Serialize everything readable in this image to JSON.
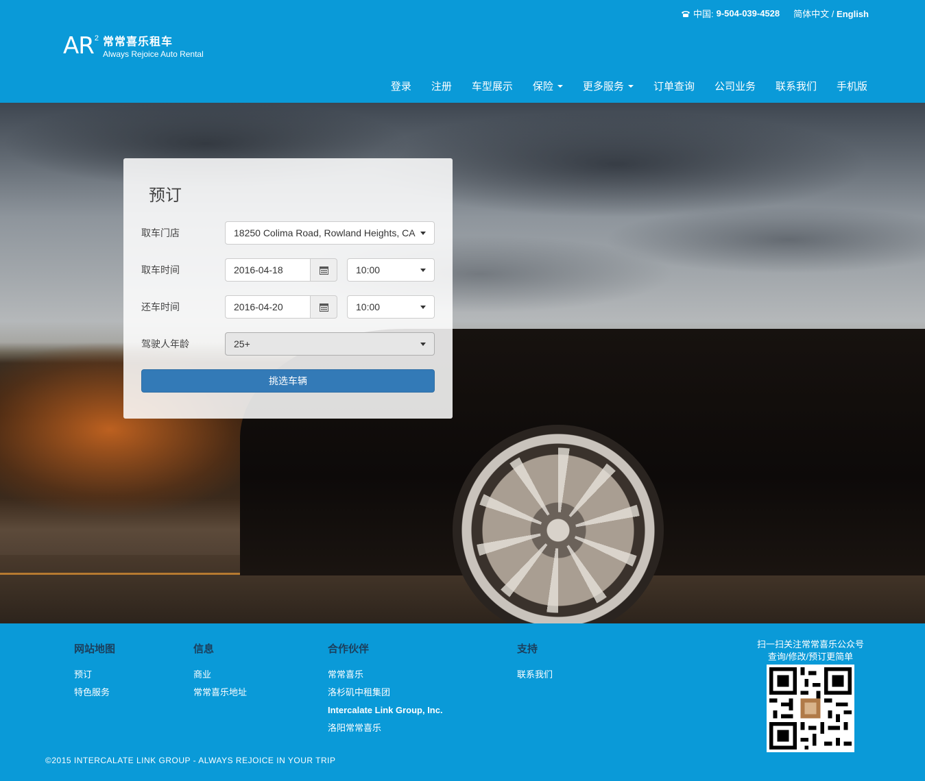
{
  "header": {
    "phone_label": "中国:",
    "phone_number": "9-504-039-4528",
    "lang_cn": "简体中文",
    "lang_sep": "/",
    "lang_en": "English",
    "logo_mark": "AR",
    "logo_sup": "2",
    "logo_cn": "常常喜乐租车",
    "logo_en": "Always Rejoice Auto Rental"
  },
  "nav": {
    "items": [
      {
        "label": "登录",
        "dropdown": false
      },
      {
        "label": "注册",
        "dropdown": false
      },
      {
        "label": "车型展示",
        "dropdown": false
      },
      {
        "label": "保险",
        "dropdown": true
      },
      {
        "label": "更多服务",
        "dropdown": true
      },
      {
        "label": "订单查询",
        "dropdown": false
      },
      {
        "label": "公司业务",
        "dropdown": false
      },
      {
        "label": "联系我们",
        "dropdown": false
      },
      {
        "label": "手机版",
        "dropdown": false
      }
    ]
  },
  "booking": {
    "title": "预订",
    "pickup_store_label": "取车门店",
    "pickup_store_value": "18250 Colima Road, Rowland Heights, CA",
    "pickup_time_label": "取车时间",
    "pickup_date": "2016-04-18",
    "pickup_hour": "10:00",
    "return_time_label": "还车时间",
    "return_date": "2016-04-20",
    "return_hour": "10:00",
    "driver_age_label": "驾驶人年龄",
    "driver_age_value": "25+",
    "submit_label": "挑选车辆"
  },
  "footer": {
    "sitemap": {
      "title": "网站地图",
      "links": [
        "预订",
        "特色服务"
      ]
    },
    "info": {
      "title": "信息",
      "links": [
        "商业",
        "常常喜乐地址"
      ]
    },
    "partners": {
      "title": "合作伙伴",
      "links": [
        "常常喜乐",
        "洛杉矶中租集团",
        "Intercalate Link Group, Inc.",
        "洛阳常常喜乐"
      ]
    },
    "support": {
      "title": "支持",
      "links": [
        "联系我们"
      ]
    },
    "qr_line1": "扫一扫关注常常喜乐公众号",
    "qr_line2": "查询/修改/预订更简单",
    "copyright": "©2015 INTERCALATE LINK GROUP - ALWAYS REJOICE IN YOUR TRIP"
  },
  "colors": {
    "brand_blue": "#0a9ad8",
    "button_blue": "#337ab7",
    "footer_heading": "#1c3f5c"
  },
  "icons": [
    "phone-icon",
    "calendar-icon",
    "caret-down-icon",
    "qr-code-icon"
  ]
}
